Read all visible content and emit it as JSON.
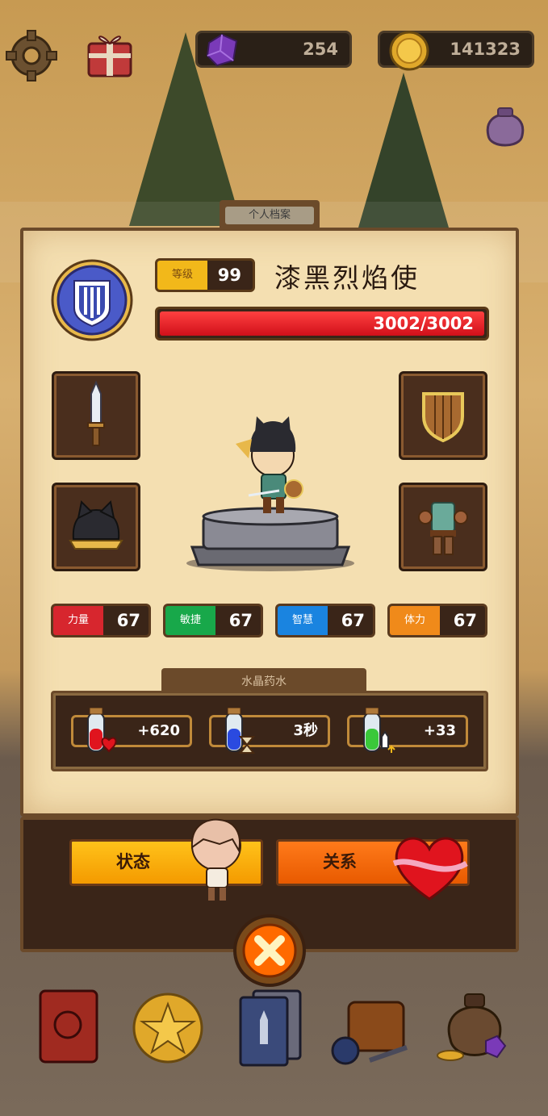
{
  "hud": {
    "gems": "254",
    "coins": "141323",
    "settings_icon": "gear-icon",
    "gift_icon": "gift-icon",
    "bag_icon": "treasure-bag-icon"
  },
  "panel": {
    "tab_title": "个人档案",
    "level_label": "等级",
    "level_value": "99",
    "hero_name": "漆黑烈焰使",
    "hp_text": "3002/3002",
    "hp_fraction": 1.0,
    "emblem_icon": "shield-emblem-icon"
  },
  "equipment": {
    "weapon_icon": "dagger-icon",
    "shield_icon": "wooden-shield-icon",
    "helmet_icon": "cat-ear-helmet-icon",
    "armor_icon": "leather-armor-icon"
  },
  "stats": [
    {
      "label": "力量",
      "value": "67",
      "color": "#d7262e"
    },
    {
      "label": "敏捷",
      "value": "67",
      "color": "#18a84a"
    },
    {
      "label": "智慧",
      "value": "67",
      "color": "#1a84e0"
    },
    {
      "label": "体力",
      "value": "67",
      "color": "#f08a1a"
    }
  ],
  "potions": {
    "title": "水晶药水",
    "items": [
      {
        "value": "+620",
        "icon": "red-heart-potion-icon"
      },
      {
        "value": "3秒",
        "icon": "blue-hourglass-potion-icon"
      },
      {
        "value": "+33",
        "icon": "green-sword-potion-icon"
      }
    ]
  },
  "bottom": {
    "status_label": "状态",
    "relation_label": "关系",
    "close_icon": "close-icon"
  },
  "menu": [
    {
      "icon": "journal-book-icon"
    },
    {
      "icon": "star-coin-icon"
    },
    {
      "icon": "card-deck-icon"
    },
    {
      "icon": "adventure-bag-icon"
    },
    {
      "icon": "loot-sack-icon"
    }
  ],
  "colors": {
    "panel": "#f4dfb1",
    "frame": "#6b4a2a",
    "hp_bar": "#e0141e",
    "status_button": "#ffaa00",
    "relation_button": "#ff6a00"
  }
}
